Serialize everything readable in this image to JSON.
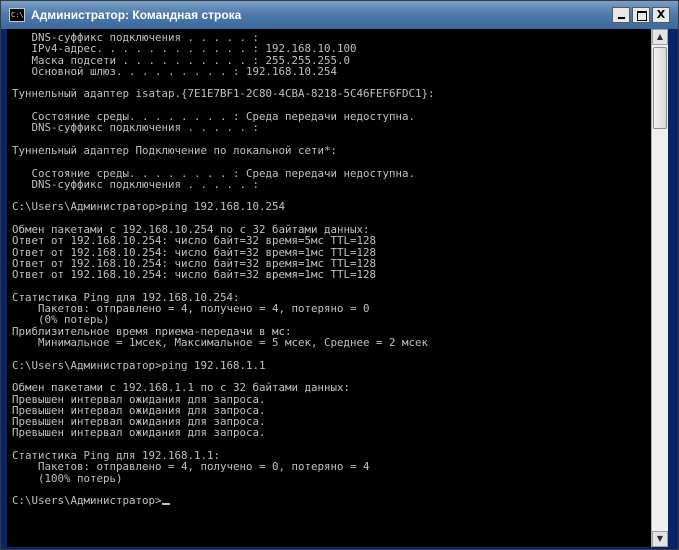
{
  "window": {
    "title": "Администратор: Командная строка",
    "icon_text": "C:\\",
    "icon_name": "cmd-icon"
  },
  "caption_buttons": {
    "minimize": "",
    "maximize": "",
    "close": "X"
  },
  "console": {
    "prompt": "C:\\Users\\Администратор>",
    "lines": [
      "   DNS-суффикс подключения . . . . . :",
      "   IPv4-адрес. . . . . . . . . . . . : 192.168.10.100",
      "   Маска подсети . . . . . . . . . . : 255.255.255.0",
      "   Основной шлюз. . . . . . . . . : 192.168.10.254",
      "",
      "Туннельный адаптер isatap.{7E1E7BF1-2C80-4CBA-8218-5C46FEF6FDC1}:",
      "",
      "   Состояние среды. . . . . . . . : Среда передачи недоступна.",
      "   DNS-суффикс подключения . . . . . :",
      "",
      "Туннельный адаптер Подключение по локальной сети*:",
      "",
      "   Состояние среды. . . . . . . . : Среда передачи недоступна.",
      "   DNS-суффикс подключения . . . . . :",
      "",
      "C:\\Users\\Администратор>ping 192.168.10.254",
      "",
      "Обмен пакетами с 192.168.10.254 по с 32 байтами данных:",
      "Ответ от 192.168.10.254: число байт=32 время=5мс TTL=128",
      "Ответ от 192.168.10.254: число байт=32 время=1мс TTL=128",
      "Ответ от 192.168.10.254: число байт=32 время=1мс TTL=128",
      "Ответ от 192.168.10.254: число байт=32 время=1мс TTL=128",
      "",
      "Статистика Ping для 192.168.10.254:",
      "    Пакетов: отправлено = 4, получено = 4, потеряно = 0",
      "    (0% потерь)",
      "Приблизительное время приема-передачи в мс:",
      "    Минимальное = 1мсек, Максимальное = 5 мсек, Среднее = 2 мсек",
      "",
      "C:\\Users\\Администратор>ping 192.168.1.1",
      "",
      "Обмен пакетами с 192.168.1.1 по с 32 байтами данных:",
      "Превышен интервал ожидания для запроса.",
      "Превышен интервал ожидания для запроса.",
      "Превышен интервал ожидания для запроса.",
      "Превышен интервал ожидания для запроса.",
      "",
      "Статистика Ping для 192.168.1.1:",
      "    Пакетов: отправлено = 4, получено = 0, потеряно = 4",
      "    (100% потерь)",
      ""
    ]
  },
  "scrollbar": {
    "up_arrow_icon": "scroll-up-arrow-icon",
    "down_arrow_icon": "scroll-down-arrow-icon",
    "position_fraction": 0.0
  },
  "colors": {
    "console_background": "#000000",
    "console_text": "#c0c0c0",
    "title_text": "#ffffff"
  }
}
